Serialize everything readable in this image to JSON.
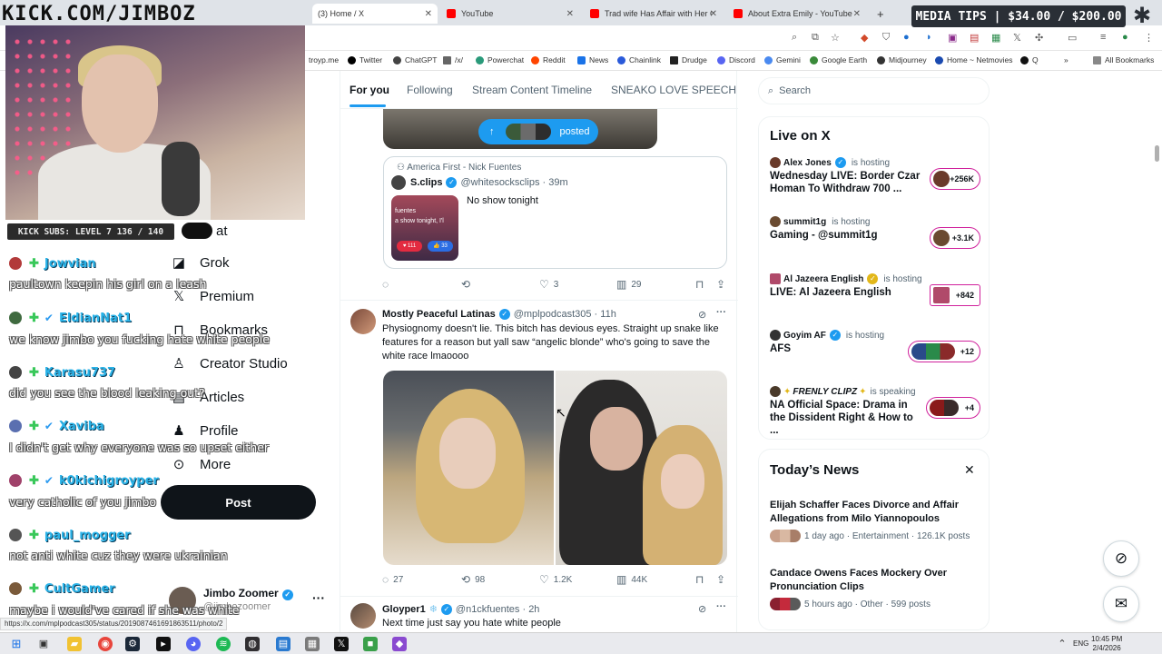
{
  "browser": {
    "tabs": [
      {
        "label": "(3) Home / X",
        "color": "#000000"
      },
      {
        "label": "YouTube",
        "color": "#ff0000"
      },
      {
        "label": "Trad wife Has Affair with Her Co",
        "color": "#ff0000"
      },
      {
        "label": "About Extra Emily - YouTube",
        "color": "#ff0000"
      }
    ],
    "new_tab": "+",
    "bookmarks": [
      "troyp.me",
      "Twitter",
      "ChatGPT",
      "/x/",
      "Powerchat",
      "Reddit",
      "News",
      "Chainlink",
      "Drudge",
      "Discord",
      "Gemini",
      "Google Earth",
      "Midjourney",
      "Home ~ Netmovies",
      "Q"
    ],
    "all_bookmarks": "All Bookmarks",
    "status_url": "https://x.com/mplpodcast305/status/2019087461691863511/photo/2"
  },
  "stream": {
    "url_banner": "KICK.COM/JIMBOZ",
    "media_tips": "MEDIA TIPS | $34.00 / $200.00",
    "subs_goal": "KICK SUBS: LEVEL 7 136 / 140",
    "chat": [
      {
        "user": "Jowvian",
        "verified": false,
        "color": "#b23a3a",
        "message": "paultown keepin his girl on a leash"
      },
      {
        "user": "EldianNat1",
        "verified": true,
        "color": "#3f6a3f",
        "message": "we know jimbo you fucking hate white people"
      },
      {
        "user": "Karasu737",
        "verified": false,
        "color": "#444444",
        "message": "did you see the blood leaking out?"
      },
      {
        "user": "Xaviba",
        "verified": true,
        "color": "#5a6fb0",
        "message": "I didn't get why everyone was so upset either"
      },
      {
        "user": "k0kichigroyper",
        "verified": true,
        "color": "#a0426a",
        "message": "very catholic of you jimbo"
      },
      {
        "user": "paul_mogger",
        "verified": false,
        "color": "#555555",
        "message": "not anti white cuz they were ukrainian"
      },
      {
        "user": "CultGamer",
        "verified": false,
        "color": "#7a5a3a",
        "message": "maybe i would've cared if she was white"
      }
    ]
  },
  "x_nav": {
    "items": [
      {
        "label": "Grok",
        "icon": "grok-icon",
        "glyph": "◪"
      },
      {
        "label": "Premium",
        "icon": "x-logo-icon",
        "glyph": "𝕏"
      },
      {
        "label": "Bookmarks",
        "icon": "bookmark-icon",
        "glyph": "⊓"
      },
      {
        "label": "Creator Studio",
        "icon": "creator-studio-icon",
        "glyph": "♙"
      },
      {
        "label": "Articles",
        "icon": "articles-icon",
        "glyph": "▤"
      },
      {
        "label": "Profile",
        "icon": "profile-icon",
        "glyph": "♟"
      },
      {
        "label": "More",
        "icon": "more-circle-icon",
        "glyph": "⊙"
      }
    ],
    "partial_label": "at",
    "post_button": "Post",
    "account": {
      "name": "Jimbo Zoomer",
      "handle": "@jimbozoomer"
    }
  },
  "feed": {
    "tabs": [
      "For you",
      "Following",
      "Stream Content Timeline",
      "SNEAKO LOVE SPEECH"
    ],
    "posted_pill": "posted",
    "quote": {
      "community": "America First - Nick Fuentes",
      "name": "S.clips",
      "handle": "@whitesocksclips",
      "time": "39m",
      "text": "No show tonight",
      "thumb_text": "fuentes\na show tonight, I'l",
      "thumb_reaction_1": "111",
      "thumb_reaction_2": "33"
    },
    "quote_actions": {
      "reply": "",
      "repost": "",
      "like": "3",
      "views": "29"
    },
    "tweet2": {
      "name": "Mostly Peaceful Latinas",
      "handle": "@mplpodcast305",
      "time": "11h",
      "text": "Physiognomy doesn't lie. This bitch has devious eyes. Straight up snake like features for a reason but yall saw “angelic blonde” who's going to save the white race lmaoooo",
      "actions": {
        "reply": "27",
        "repost": "98",
        "like": "1.2K",
        "views": "44K"
      }
    },
    "tweet3": {
      "name": "Gloyper1",
      "handle": "@n1ckfuentes",
      "time": "2h",
      "text": "Next time just say you hate white people"
    }
  },
  "sidebar": {
    "search_placeholder": "Search",
    "live_title": "Live on X",
    "live": [
      {
        "host": "Alex Jones",
        "status": "is hosting",
        "title": "Wednesday LIVE: Border Czar Homan To Withdraw 700 ...",
        "count": "+256K",
        "badge": "blue",
        "avatar_color": "#6a3a2a"
      },
      {
        "host": "summit1g",
        "status": "is hosting",
        "title": "Gaming - @summit1g",
        "count": "+3.1K",
        "badge": "none",
        "avatar_color": "#6a4a30"
      },
      {
        "host": "Al Jazeera English",
        "status": "is hosting",
        "title": "LIVE: Al Jazeera English",
        "count": "+842",
        "badge": "gold",
        "avatar_color": "#b04a6a"
      },
      {
        "host": "Goyim AF",
        "status": "is hosting",
        "title": "AFS",
        "count": "+12",
        "badge": "blue",
        "avatar_color": "#333333"
      },
      {
        "host": "FRENLY CLIPZ",
        "status": "is speaking",
        "title": "NA Official Space: Drama in the Dissident Right & How to ...",
        "count": "+4",
        "badge": "none",
        "avatar_color": "#4a3a2a"
      }
    ],
    "news_title": "Today’s News",
    "news": [
      {
        "headline": "Elijah Schaffer Faces Divorce and Affair Allegations from Milo Yiannopoulos",
        "meta": "1 day ago · Entertainment · 126.1K posts"
      },
      {
        "headline": "Candace Owens Faces Mockery Over Pronunciation Clips",
        "meta": "5 hours ago · Other · 599 posts"
      }
    ]
  },
  "taskbar": {
    "lang": "ENG",
    "time": "10:45 PM",
    "date": "2/4/2026"
  },
  "colors": {
    "accent": "#1d9bf0",
    "text": "#0f1419",
    "muted": "#536471",
    "chat_name": "#2ab3e8",
    "badge_green": "#39c85a"
  }
}
